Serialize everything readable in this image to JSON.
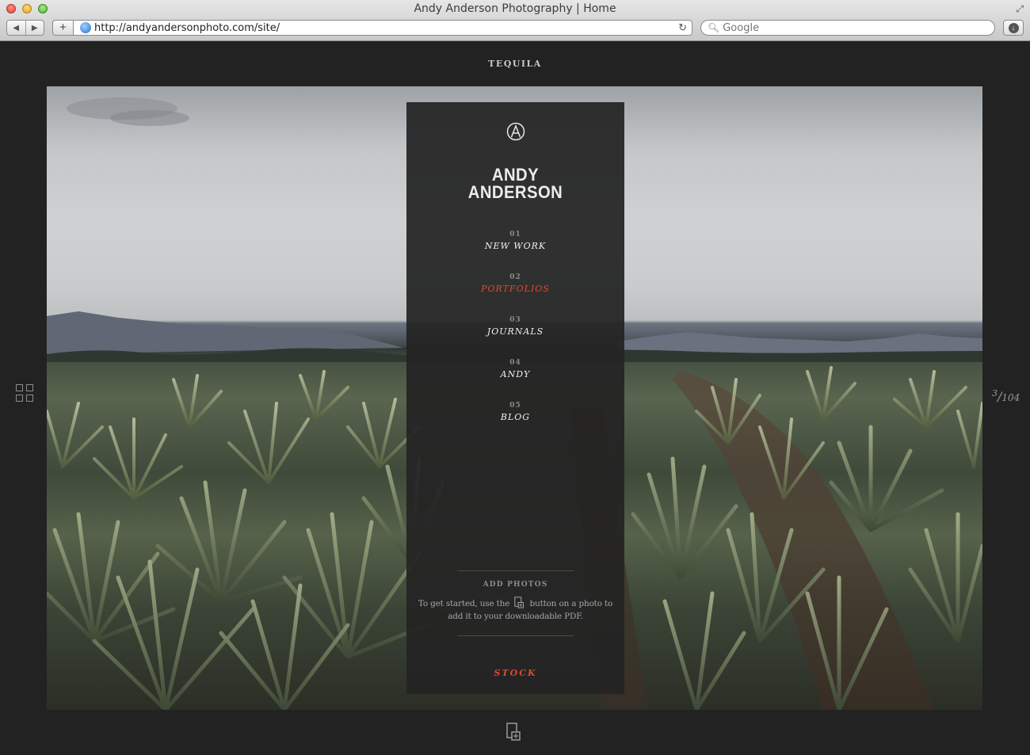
{
  "browser": {
    "window_title": "Andy Anderson Photography | Home",
    "url": "http://andyandersonphoto.com/site/",
    "search_placeholder": "Google"
  },
  "gallery": {
    "title": "TEQUILA",
    "counter_current": "3",
    "counter_total": "104"
  },
  "menu": {
    "brand_line1": "ANDY",
    "brand_line2": "ANDERSON",
    "items": [
      {
        "num": "01",
        "label": "NEW WORK",
        "active": false
      },
      {
        "num": "02",
        "label": "PORTFOLIOS",
        "active": true
      },
      {
        "num": "03",
        "label": "JOURNALS",
        "active": false
      },
      {
        "num": "04",
        "label": "ANDY",
        "active": false
      },
      {
        "num": "05",
        "label": "BLOG",
        "active": false
      }
    ],
    "add_photos": {
      "heading": "ADD PHOTOS",
      "text_before": "To get started, use the",
      "text_after": "button on a photo to add it to your downloadable PDF."
    },
    "stock_label": "STOCK"
  },
  "colors": {
    "accent": "#e0492a",
    "panel": "#242424",
    "page_background": "#222222"
  },
  "icons": {
    "logo": "logo-a-circle-icon",
    "grid": "grid-view-icon",
    "add_to_pdf": "add-to-pdf-icon"
  }
}
